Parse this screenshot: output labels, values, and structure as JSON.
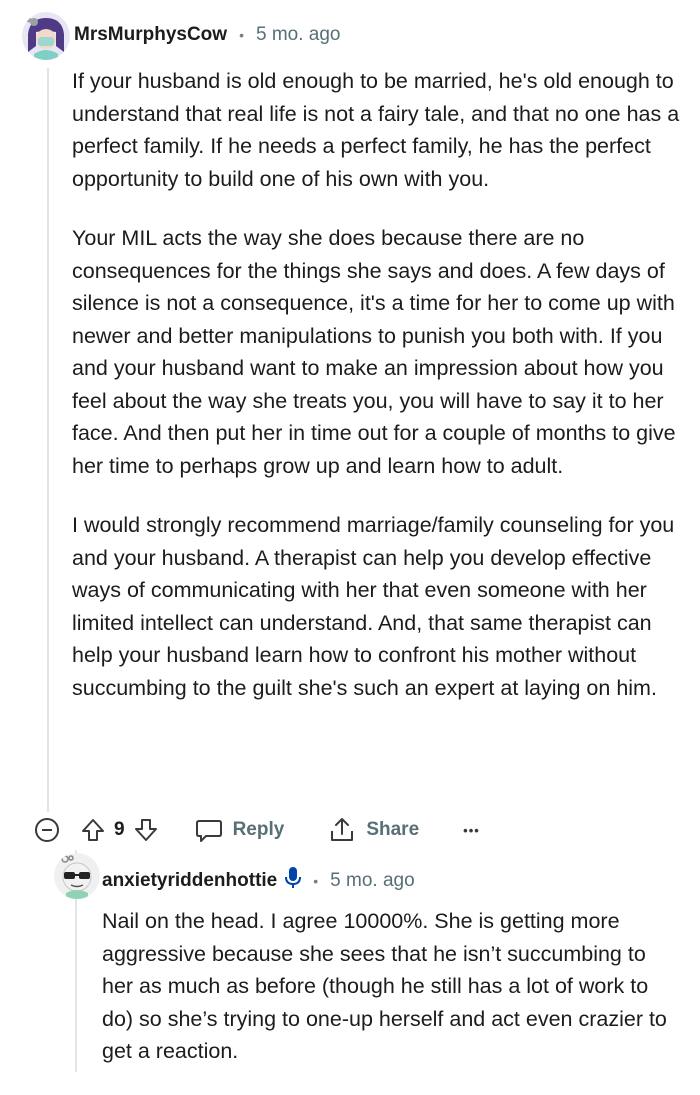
{
  "comment": {
    "username": "MrsMurphysCow",
    "separator": "•",
    "time": "5 mo. ago",
    "paragraphs": [
      "If your husband is old enough to be married, he's old enough to understand that real life is not a fairy tale, and that no one has a perfect family. If he needs a perfect family, he has the perfect opportunity to build one of his own with you.",
      "Your MIL acts the way she does because there are no consequences for the things she says and does. A few days of silence is not a consequence, it's a time for her to come up with newer and better manipulations to punish you both with. If you and your husband want to make an impression about how you feel about the way she treats you, you will have to say it to her face. And then put her in time out for a couple of months to give her time to perhaps grow up and learn how to adult.",
      "I would strongly recommend marriage/family counseling for you and your husband. A therapist can help you develop effective ways of communicating with her that even someone with her limited intellect can understand. And, that same therapist can help your husband learn how to confront his mother without succumbing to the guilt she's such an expert at laying on him."
    ],
    "actions": {
      "vote_count": "9",
      "reply_label": "Reply",
      "share_label": "Share",
      "more_label": "•••"
    }
  },
  "reply": {
    "username": "anxietyriddenhottie",
    "separator": "•",
    "time": "5 mo. ago",
    "text": "Nail on the head. I agree 10000%. She is getting more aggressive because she sees that he isn’t succumbing to her as much as before (though he still has a lot of work to do) so she’s trying to one-up herself and act even crazier to get a reaction."
  },
  "colors": {
    "meta_gray": "#576f76",
    "text": "#1c1c1c",
    "thread_line": "#e2e4e6",
    "mic_blue": "#0045ac"
  },
  "icons": [
    "collapse-icon",
    "upvote-icon",
    "downvote-icon",
    "reply-bubble-icon",
    "share-icon",
    "voice-mic-icon"
  ]
}
